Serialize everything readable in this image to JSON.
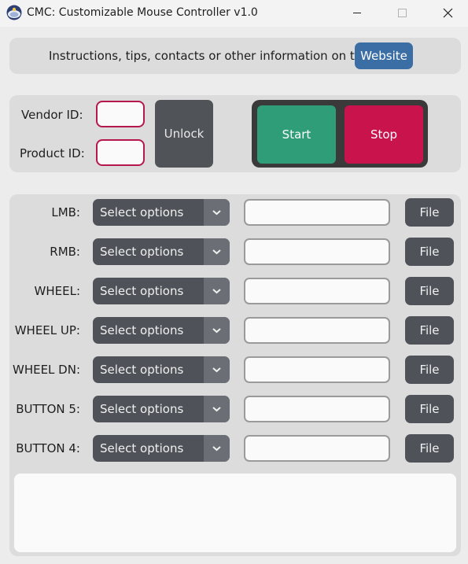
{
  "window": {
    "title": "CMC: Customizable Mouse Controller v1.0"
  },
  "info": {
    "text": "Instructions, tips, contacts or other information on the",
    "website_label": "Website"
  },
  "ids": {
    "vendor_label": "Vendor ID:",
    "vendor_value": "",
    "product_label": "Product ID:",
    "product_value": "",
    "unlock_label": "Unlock"
  },
  "controls": {
    "start_label": "Start",
    "stop_label": "Stop"
  },
  "mappings": [
    {
      "label": "LMB:",
      "select": "Select options",
      "path": "",
      "file_label": "File"
    },
    {
      "label": "RMB:",
      "select": "Select options",
      "path": "",
      "file_label": "File"
    },
    {
      "label": "WHEEL:",
      "select": "Select options",
      "path": "",
      "file_label": "File"
    },
    {
      "label": "WHEEL UP:",
      "select": "Select options",
      "path": "",
      "file_label": "File"
    },
    {
      "label": "WHEEL DN:",
      "select": "Select options",
      "path": "",
      "file_label": "File"
    },
    {
      "label": "BUTTON 5:",
      "select": "Select options",
      "path": "",
      "file_label": "File"
    },
    {
      "label": "BUTTON 4:",
      "select": "Select options",
      "path": "",
      "file_label": "File"
    }
  ],
  "log": {
    "text": ""
  },
  "colors": {
    "website_button": "#3b6ea5",
    "start_button": "#2f9e78",
    "stop_button": "#c8134d",
    "id_input_border": "#b5184a",
    "dark_button": "#4f5258"
  }
}
